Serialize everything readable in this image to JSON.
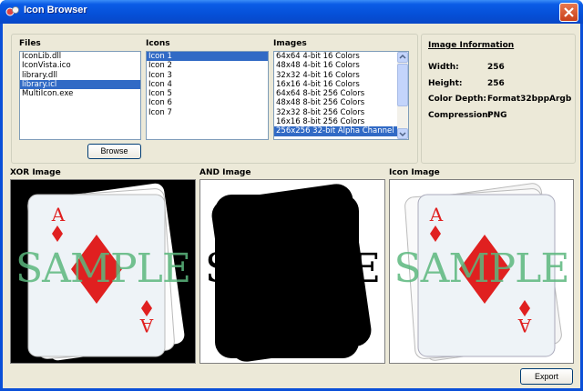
{
  "window": {
    "title": "Icon Browser"
  },
  "files": {
    "label": "Files",
    "items": [
      "IconLib.dll",
      "IconVista.ico",
      "library.dll",
      "library.icl",
      "MultiIcon.exe"
    ],
    "selected_index": 3
  },
  "icons": {
    "label": "Icons",
    "items": [
      "Icon 1",
      "Icon 2",
      "Icon 3",
      "Icon 4",
      "Icon 5",
      "Icon 6",
      "Icon 7"
    ],
    "selected_index": 0
  },
  "images": {
    "label": "Images",
    "items": [
      "64x64 4-bit 16 Colors",
      "48x48 4-bit 16 Colors",
      "32x32 4-bit 16 Colors",
      "16x16 4-bit 16 Colors",
      "64x64 8-bit 256 Colors",
      "48x48 8-bit 256 Colors",
      "32x32 8-bit 256 Colors",
      "16x16 8-bit 256 Colors",
      "256x256 32-bit Alpha Channel"
    ],
    "selected_index": 8
  },
  "browse_label": "Browse",
  "export_label": "Export",
  "info": {
    "title": "Image Information",
    "width_label": "Width:",
    "width_value": "256",
    "height_label": "Height:",
    "height_value": "256",
    "depth_label": "Color Depth:",
    "depth_value": "Format32bppArgb",
    "compression_label": "Compression:",
    "compression_value": "PNG"
  },
  "panels": {
    "xor_label": "XOR Image",
    "and_label": "AND Image",
    "icon_label": "Icon Image"
  },
  "card": {
    "rank": "A",
    "watermark": "SAMPLE"
  },
  "colors": {
    "titlebar": "#0550d8",
    "selection": "#316ac5",
    "watermark": "#5cb87e",
    "card_red": "#e02020"
  }
}
